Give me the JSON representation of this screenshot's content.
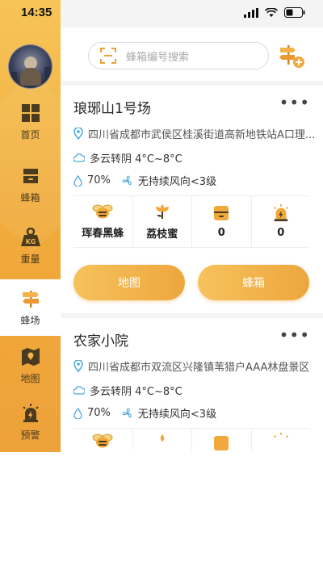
{
  "status_bar": {
    "time": "14:35"
  },
  "colors": {
    "accent": "#f0a93a",
    "accent_light": "#f7c458",
    "icon_blue": "#4aa8e0"
  },
  "sidebar": {
    "items": [
      {
        "label": "首页",
        "icon": "grid-icon"
      },
      {
        "label": "蜂箱",
        "icon": "hive-box-icon"
      },
      {
        "label": "重量",
        "icon": "weight-icon"
      },
      {
        "label": "蜂场",
        "icon": "signpost-icon",
        "active": true
      },
      {
        "label": "地图",
        "icon": "map-icon"
      },
      {
        "label": "预警",
        "icon": "alarm-icon"
      }
    ]
  },
  "search": {
    "placeholder": "蜂箱编号搜索"
  },
  "farms": [
    {
      "name": "琅琊山1号场",
      "address": "四川省成都市武侯区桂溪街道高新地铁站A口理...",
      "weather": "多云转阴 4°C~8°C",
      "humidity": "70%",
      "wind": "无持续风向<3级",
      "stats": [
        {
          "icon": "bee-icon",
          "value": "珲春黑蜂"
        },
        {
          "icon": "flower-icon",
          "value": "荔枝蜜"
        },
        {
          "icon": "hive-box-icon",
          "value": "0"
        },
        {
          "icon": "alarm-icon",
          "value": "0"
        }
      ],
      "buttons": {
        "map": "地图",
        "hive": "蜂箱"
      }
    },
    {
      "name": "农家小院",
      "address": "四川省成都市双流区兴隆镇苇猎户AAA林盘景区",
      "weather": "多云转阴 4°C~8°C",
      "humidity": "70%",
      "wind": "无持续风向<3级"
    }
  ]
}
